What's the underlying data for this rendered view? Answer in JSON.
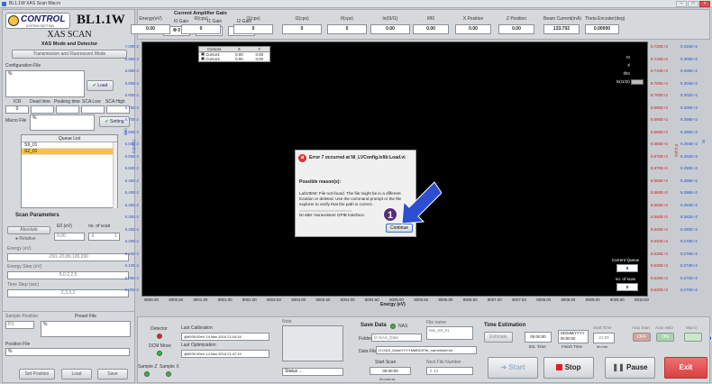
{
  "window": {
    "title": "BL1.1W XAS Scan Macro"
  },
  "header": {
    "logo_text": "CONTROL",
    "logo_sub": "SYSTEM SECTION",
    "beamline": "BL1.1W",
    "scan_title": "XAS SCAN",
    "scan_subtitle": "XAS Mode and Detector"
  },
  "left": {
    "mode_button": "Transmission and Fluorescent Mode",
    "config_label": "Configuration File",
    "config_value": "%",
    "load_label": "Load",
    "icr_label": "ICR",
    "dead_label": "Dead time",
    "peak_label": "Peaking time",
    "sca_low_label": "SCA Low",
    "sca_high_label": "SCA High",
    "icr_value": "0",
    "macro_label": "Macro File",
    "macro_value": "%",
    "setting_label": "Setting",
    "queue_title": "Queue List",
    "queue": [
      "S9_01",
      "S2_01"
    ],
    "scan_params": "Scan Parameters",
    "absolute": "Absolute",
    "relative": "Relative",
    "e0_label": "E0 (eV)",
    "e0_value": "0.00",
    "noscan_label": "no. of scan",
    "noscan_value": "1",
    "energy_label": "Energy (eV)",
    "energy_value": "-150,-20,80,100,200",
    "estep_label": "Energy Step (eV)",
    "estep_value": "5,0.2,2,5",
    "tstep_label": "Time Step (sec)",
    "tstep_value": "2,3,3,2",
    "sample_pos_label": "Sample Position",
    "sample_pos_value": "P3",
    "preset_label": "Preset File",
    "preset_value": "%",
    "position_label": "Position File",
    "position_value": "%",
    "set_position": "Set Position",
    "load2": "Load",
    "save": "Save"
  },
  "top": {
    "gain_title": "Current Amplifier Gain",
    "overload_label": "Overload?",
    "i0_gain_label": "I0 Gain",
    "i1_gain_label": "I1 Gain",
    "i2_gain_label": "I2 Gain",
    "i0_gain": "0",
    "i1_gain": "0",
    "i2_gain": "0",
    "readouts": [
      {
        "label": "Energy(eV)",
        "value": "0.00"
      },
      {
        "label": "I0(cps)",
        "value": "0"
      },
      {
        "label": "I1(cps)",
        "value": "0"
      },
      {
        "label": "I2(cps)",
        "value": "0"
      },
      {
        "label": "If(cps)",
        "value": "0"
      },
      {
        "label": "ln(I0/I1)",
        "value": "0.00"
      },
      {
        "label": "If/I0",
        "value": "0.00"
      },
      {
        "label": "X Position",
        "value": "0.00"
      },
      {
        "label": "Z Position",
        "value": "0.00"
      },
      {
        "label": "Beam Current(mA)",
        "value": "133.702"
      },
      {
        "label": "Theta Encoder(deg)",
        "value": "0.00000"
      }
    ]
  },
  "plot": {
    "cursors_header": [
      "Cursors",
      "X",
      "Y"
    ],
    "cursors": [
      [
        "Cursor1",
        "0.00",
        "0.00"
      ],
      [
        "Cursor2",
        "0.00",
        "0.00"
      ]
    ],
    "legend": [
      "I0",
      "If",
      "If/I0",
      "ln(I1/I2)"
    ],
    "ylabel_left": "If/I0",
    "ylabel_left2": "ln(I0/I1)",
    "ylabel_right": "I0",
    "ylabel_right2": "If (cps)",
    "xlabel": "Energy (eV)",
    "yleft": [
      "7.00E-2",
      "6.95E-2",
      "6.90E-2",
      "6.85E-2",
      "6.80E-2",
      "6.75E-2",
      "6.70E-2",
      "6.65E-2",
      "6.60E-2",
      "6.55E-2",
      "6.50E-2",
      "6.45E-2",
      "6.40E-2",
      "6.35E-2",
      "6.30E-2",
      "6.25E-2",
      "6.20E-2",
      "6.15E-2",
      "6.10E-2",
      "6.05E-2",
      "6.00E-2"
    ],
    "yright1": [
      "8.720E+2",
      "8.715E+2",
      "8.710E+2",
      "8.705E+2",
      "8.700E+2",
      "8.695E+2",
      "8.690E+2",
      "8.685E+2",
      "8.680E+2",
      "8.675E+2",
      "8.670E+2",
      "8.665E+2",
      "8.660E+2",
      "8.655E+2",
      "8.650E+2",
      "8.645E+2",
      "8.640E+2",
      "8.635E+2",
      "8.630E+2",
      "8.625E+2",
      "8.620E+2"
    ],
    "yright2": [
      "9.310E+2",
      "9.308E+2",
      "9.306E+2",
      "9.304E+2",
      "9.302E+2",
      "9.300E+2",
      "9.298E+2",
      "9.296E+2",
      "9.294E+2",
      "9.292E+2",
      "9.290E+2",
      "9.288E+2",
      "9.286E+2",
      "9.284E+2",
      "9.282E+2",
      "9.280E+2",
      "9.278E+2",
      "9.276E+2",
      "9.274E+2",
      "9.272E+2",
      "9.270E+2"
    ],
    "xticks": [
      "8000.00",
      "8000.50",
      "8001.00",
      "8001.50",
      "8002.00",
      "8002.50",
      "8003.00",
      "8003.50",
      "8004.00",
      "8004.50",
      "8005.00",
      "8005.50",
      "8006.00",
      "8006.50",
      "8007.00",
      "8007.50",
      "8008.00",
      "8008.50",
      "8009.00",
      "8009.50",
      "8010.00"
    ],
    "current_queue_label": "Current Queue",
    "current_queue_value": "0",
    "noscan_label": "no. of scan",
    "noscan_value": "0"
  },
  "dialog": {
    "title": "Error 7 occurred at NI_LVConfig.lvlib:Load.vi",
    "reason_title": "Possible reason(s):",
    "body": "LabVIEW:  File not found. The file might be in a different location or deleted. Use the command prompt or the file explorer to verify that the path is correct.",
    "sep": "=========================",
    "gpib": "NI-488:  Nonexistent GPIB interface.",
    "continue": "Continue"
  },
  "bottom": {
    "detector": "Detector",
    "dcm_move": "DCM Move",
    "sample_z": "Sample Z",
    "sample_x": "Sample X",
    "last_calibration": "Last Calibration",
    "calibration_value": "@8939.00eV 14 Mar 2018 21:04:34",
    "last_optimization": "Last Optimization",
    "optimization_value": "@8939.00eV 14 Mar 2018 21:47:19",
    "note_label": "Note",
    "status_label": "Status ...",
    "save_data": "Save Data",
    "nas": "NAS",
    "folder_label": "Folder",
    "folder_value": "D:\\XAS_Data",
    "file_name_label": "File name",
    "file_name_value": "Mix_S9_01",
    "data_file_label": "Data File",
    "data_file_value": "D:\\XAS_Data\\YYYYMMDD\\File_name####.txt",
    "start_scan_label": "Start Scan",
    "start_scan_value": "00:00:00",
    "hms1": "hh:mm:ss",
    "next_file_label": "Next File Number",
    "next_file_value": "43",
    "time_estimation": "Time Estimation",
    "estimate": "Estimate",
    "est_time": "00:00:00",
    "est_time_label": "Est. Time",
    "finish_date": "DD/MM/YYYY 00:00:00",
    "finish_label": "Finish Time",
    "start_time_label": "Start Time",
    "start_time_value": "21:00",
    "hhmm": "hh:mm",
    "auto_start": "Auto Start",
    "auto_start_val": "OFF",
    "auto_abo": "Auto ABO",
    "auto_abo_val": "ON",
    "macro": "Macro",
    "start": "Start",
    "stop": "Stop",
    "pause": "Pause",
    "exit": "Exit"
  },
  "badges": {
    "one": "1",
    "two": "2"
  },
  "colors": {
    "plot_bg": "#000000",
    "accent_yellow": "#f5c242",
    "exit_red": "#e64a4a",
    "badge_purple": "#5a2a80",
    "arrow_blue": "#2b4fd0"
  }
}
